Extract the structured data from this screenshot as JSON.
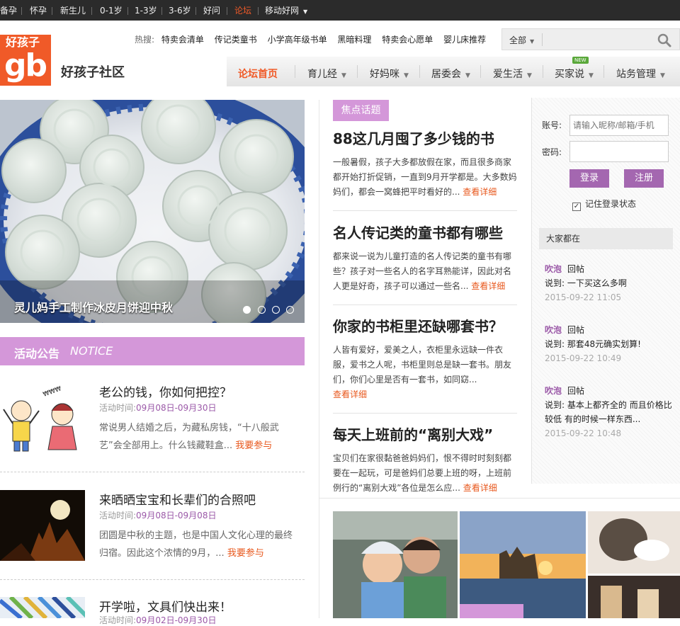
{
  "topbar": {
    "items": [
      "备孕",
      "怀孕",
      "新生儿",
      "0-1岁",
      "1-3岁",
      "3-6岁",
      "好问",
      "论坛",
      "移动好网"
    ],
    "active": "论坛"
  },
  "logo": {
    "line1": "好孩子",
    "line2": "gb"
  },
  "site_name": "好孩子社区",
  "hot": {
    "label": "热搜:",
    "keywords": [
      "特卖会清单",
      "传记类童书",
      "小学高年级书单",
      "黑暗料理",
      "特卖会心愿单",
      "婴儿床推荐"
    ]
  },
  "search": {
    "scope": "全部",
    "value": ""
  },
  "nav": {
    "items": [
      "论坛首页",
      "育儿经",
      "好妈咪",
      "居委会",
      "爱生活",
      "买家说",
      "站务管理"
    ],
    "new_badge": "NEW"
  },
  "slider": {
    "caption": "灵儿妈手工制作冰皮月饼迎中秋",
    "dot_count": 4,
    "active_dot": 0
  },
  "notice": {
    "title": "活动公告",
    "title_en": "NOTICE"
  },
  "activities": [
    {
      "title": "老公的钱，你如何把控？",
      "time_label": "活动时间:",
      "time": "09月08日-09月30日",
      "desc": "常说男人结婚之后，为藏私房钱，“十八般武艺”会全部用上。什么钱藏鞋盒...",
      "more": "我要参与"
    },
    {
      "title": "来晒晒宝宝和长辈们的合照吧",
      "time_label": "活动时间:",
      "time": "09月08日-09月08日",
      "desc": "团圆是中秋的主题，也是中国人文化心理的最终归宿。因此这个浓情的9月，...",
      "more": "我要参与"
    },
    {
      "title": "开学啦，文具们快出来！",
      "time_label": "活动时间:",
      "time": "09月02日-09月30日",
      "desc": "",
      "more": ""
    }
  ],
  "focus": {
    "tag": "焦点话题",
    "topics": [
      {
        "title": "88这几月囤了多少钱的书",
        "desc": "一般暑假，孩子大多都放假在家，而且很多商家都开始打折促销，一直到9月开学都是。大多数妈妈们，都会一窝蜂把平时看好的...",
        "more": "查看详细"
      },
      {
        "title": "名人传记类的童书都有哪些",
        "desc": "都来说一说为儿童打造的名人传记类的童书有哪些？孩子对一些名人的名字耳熟能详，因此对名人更是好奇，孩子可以通过一些名...",
        "more": "查看详细"
      },
      {
        "title": "你家的书柜里还缺哪套书？",
        "desc": "人皆有爱好，爱美之人，衣柜里永远缺一件衣服，爱书之人呢，书柜里则总是缺一套书。朋友们，你们心里是否有一套书，如同窈...",
        "more": "查看详细"
      },
      {
        "title": "每天上班前的“离别大戏”",
        "desc": "宝贝们在家很黏爸爸妈妈们，恨不得时时刻刻都要在一起玩，可是爸妈们总要上班的呀，上班前例行的“离别大戏”各位是怎么应...",
        "more": "查看详细"
      }
    ]
  },
  "login": {
    "account_label": "账号:",
    "account_placeholder": "请输入昵称/邮箱/手机",
    "password_label": "密码:",
    "login_button": "登录",
    "register_button": "注册",
    "remember": "记住登录状态",
    "remember_checked": true
  },
  "activity_feed": {
    "title": "大家都在",
    "items": [
      {
        "user": "吹泡",
        "action": "回帖",
        "said_label": "说到:",
        "text": "一下买这么多啊",
        "date": "2015-09-22 11:05"
      },
      {
        "user": "吹泡",
        "action": "回帖",
        "said_label": "说到:",
        "text": "那套48元确实划算!",
        "date": "2015-09-22 10:49"
      },
      {
        "user": "吹泡",
        "action": "回帖",
        "said_label": "说到:",
        "text": "基本上都齐全的 而且价格比较低 有的时候一样东西...",
        "date": "2015-09-22 10:48"
      }
    ]
  },
  "colors": {
    "accent": "#f05a28",
    "purple": "#d497d9",
    "dark_purple": "#a467b0",
    "topbar": "#2b2b2b"
  }
}
